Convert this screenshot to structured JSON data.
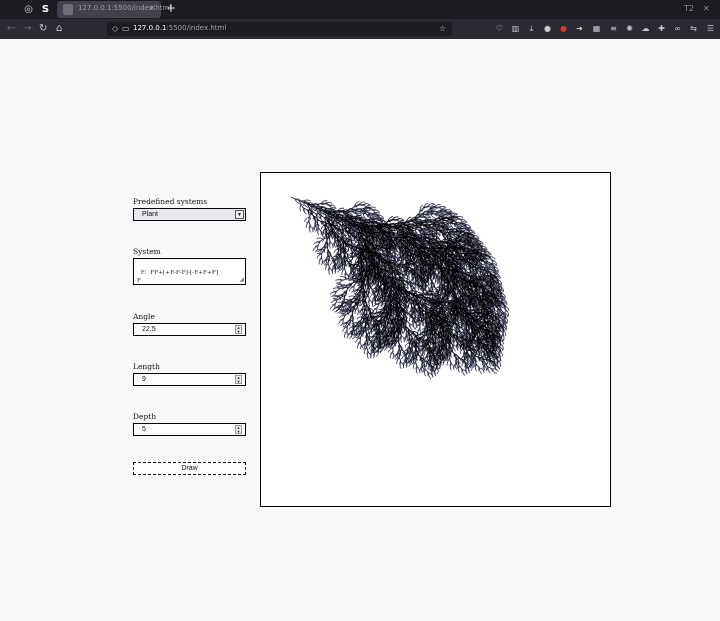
{
  "browser": {
    "tab_title": "127.0.0.1:5500/index.html",
    "tab_close": "×",
    "new_tab": "+",
    "url_host": "127.0.0.1",
    "url_path": ":5500/index.html",
    "profile_badge": "T2"
  },
  "form": {
    "predefined_label": "Predefined systems",
    "predefined_value": "Plant",
    "system_label": "System",
    "system_value": "F:  FF+[+F-F-F]-[-F+F+F]\nF",
    "angle_label": "Angle",
    "angle_value": "22.5",
    "length_label": "Length",
    "length_value": "9",
    "depth_label": "Depth",
    "depth_value": "5",
    "draw_label": "Draw"
  },
  "canvas": {
    "stroke_color": "#000000",
    "leaf_color": "#5050a0"
  }
}
